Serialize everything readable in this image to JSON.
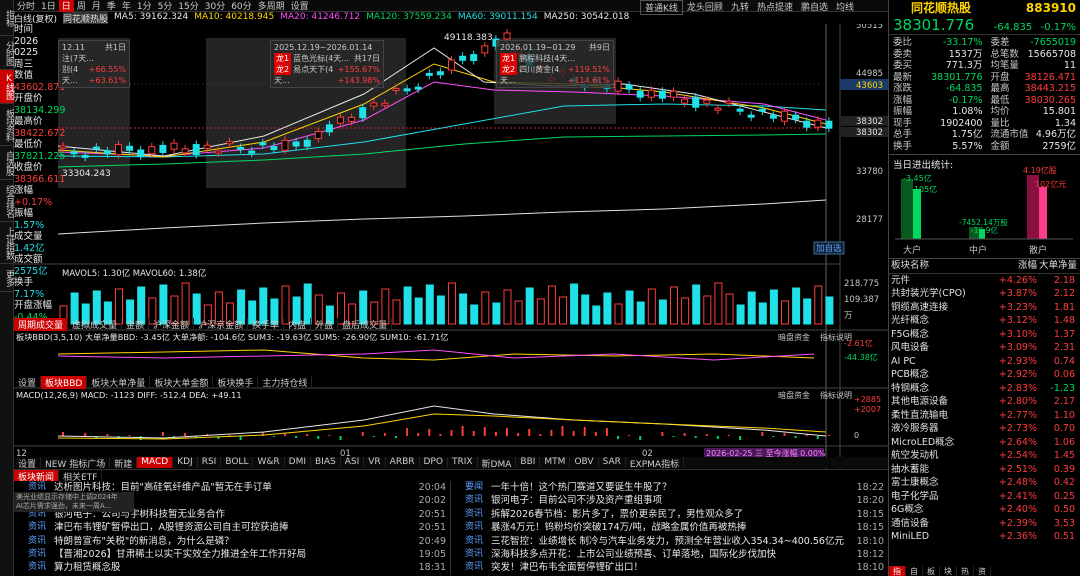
{
  "leftbar": [
    "指标",
    "分时图",
    "K线图",
    "板块资料",
    "自选股",
    "综合排名",
    "上证指数",
    "更多"
  ],
  "toolbar": {
    "items": [
      "分时",
      "1日",
      "日",
      "周",
      "月",
      "季",
      "年",
      "1分",
      "5分",
      "15分",
      "30分",
      "60分",
      "多周期",
      "设置"
    ],
    "active": "日",
    "right": [
      "普通K线",
      "龙头回顾",
      "九转",
      "热点提速",
      "鹏自选",
      "均线"
    ]
  },
  "legend": {
    "name": "白线(复权)",
    "stock": "同花顺热股",
    "ma5": "MA5: 39162.324",
    "ma10": "MA10: 40218.945",
    "ma20": "MA20: 41246.712",
    "ma120": "MA120: 37559.234",
    "ma60": "MA60: 39011.154",
    "ma250": "MA250: 30542.018"
  },
  "info": {
    "time_label": "时间",
    "date1": "2026",
    "date2": "0225",
    "weekday": "周三",
    "count_label": "数值",
    "count": "43602.871",
    "open_label": "开盘价",
    "open": "38134.299",
    "high_label": "最高价",
    "high": "38422.672",
    "low_label": "最低价",
    "low": "37821.225",
    "close_label": "收盘价",
    "close": "38366.611",
    "chg_label": "涨幅",
    "chg": "+0.17%",
    "amp_label": "振幅",
    "amp": "1.57%",
    "vol_label": "成交量",
    "vol": "1.42亿",
    "amt_label": "成交额",
    "amt": "2575亿",
    "turn_label": "换手",
    "turn": "7.17%",
    "up_label": "开盘涨幅",
    "up": "-0.44%"
  },
  "box1": {
    "range": "12.11",
    "count": "共1日",
    "r1n": "注(7天...",
    "r1v": "+66.55%",
    "r2n": "别(4天...",
    "r2v": "+63.61%"
  },
  "box2": {
    "range": "2025.12.19~2026.01.14",
    "count": "共17日",
    "r1t": "龙1",
    "r1n": "蓝色光标(4天...",
    "r1v": "+155.67%",
    "r2t": "龙2",
    "r2n": "易点天下(4天...",
    "r2v": "+143.98%"
  },
  "box3": {
    "range": "2026.01.19~01.29",
    "count": "共9日",
    "r1t": "龙1",
    "r1n": "鹏程科技(4天...",
    "r1v": "+119.51%",
    "r2t": "龙2",
    "r2n": "四川黄金(4天...",
    "r2v": "+114.61%"
  },
  "price_axis": [
    "50515",
    "44985",
    "43603",
    "38302",
    "38302",
    "33780",
    "28177"
  ],
  "peak_label": "49118.383",
  "trough_label": "33304.243",
  "addsel": "加自选",
  "volume": {
    "legend": "MAVOL5: 1.30亿  MAVOL60: 1.38亿",
    "axis": [
      "218.775",
      "109.387",
      "万"
    ]
  },
  "subtabs": [
    "周期成交量",
    "虚拟成交量",
    "金额",
    "沪深金额",
    "沪深京金额",
    "换手率",
    "内盘",
    "外盘",
    "盘后成交量"
  ],
  "bbd": {
    "legend": "板块BBD(3,5,10)  大单净量BBD: -3.45亿  大单净额: -104.6亿  SUM3: -19.63亿  SUM5: -26.90亿  SUM10: -61.71亿",
    "axis": [
      "-2.61亿",
      "-44.38亿"
    ],
    "btn1": "暗盘资金",
    "btn2": "指标说明"
  },
  "bbdtabs": [
    "设置",
    "板块BBD",
    "板块大单净量",
    "板块大单金额",
    "板块换手",
    "主力持仓线"
  ],
  "macd": {
    "legend": "MACD(12,26,9)  MACD: -1123  DIFF: -512.4  DEA: +49.11",
    "axis": [
      "+2885",
      "+2007",
      "0"
    ],
    "btn1": "暗盘资金",
    "btn2": "指标说明"
  },
  "xaxis": {
    "l1": "12",
    "l2": "01",
    "l3": "02",
    "hl": "2026-02-25 三 至今涨幅 0.00%"
  },
  "indtabs": [
    "设置",
    "NEW 指标广场",
    "新建",
    "MACD",
    "KDJ",
    "RSI",
    "BOLL",
    "W&R",
    "DMI",
    "BIAS",
    "ASI",
    "VR",
    "ARBR",
    "DPO",
    "TRIX",
    "新DMA",
    "BBI",
    "MTM",
    "OBV",
    "SAR",
    "EXPMA指标"
  ],
  "newstabs": [
    "板块新闻",
    "相关ETF"
  ],
  "news_left": [
    {
      "tag": "资讯",
      "title": "达析图片科技：目前\"高硅氧纤维产品\"暂无在手订单",
      "time": "20:04"
    },
    {
      "tag": "资讯",
      "title": "...发布利空!",
      "time": "20:02"
    },
    {
      "tag": "资讯",
      "title": "银河电子：公司与宇树科技暂无业务合作",
      "time": "20:51"
    },
    {
      "tag": "资讯",
      "title": "津巴布韦锂矿暂停出口，A股锂资源公司自主可控获追捧",
      "time": "20:51"
    },
    {
      "tag": "资讯",
      "title": "特朗普宣布\"关税\"的新消息，为什么是磷？",
      "time": "20:49"
    },
    {
      "tag": "资讯",
      "title": "【晋湘2026】甘肃稀土以实干实效全力推进全年工作开好局",
      "time": "19:05"
    },
    {
      "tag": "资讯",
      "title": "算力租赁概念股",
      "time": "18:31"
    }
  ],
  "news_right": [
    {
      "tag": "要闻",
      "title": "一年十倍！这个热门赛道又要诞生牛股了？",
      "time": "18:22"
    },
    {
      "tag": "资讯",
      "title": "银河电子：目前公司不涉及资产重组事项",
      "time": "18:20"
    },
    {
      "tag": "资讯",
      "title": "拆解2026春节档：影片多了，票价更亲民了，男性观众多了",
      "time": "18:15"
    },
    {
      "tag": "资讯",
      "title": "暴涨4万元！钨粉均价突破174万/吨，战略金属价值再被热捧",
      "time": "18:15"
    },
    {
      "tag": "资讯",
      "title": "三花智控：业绩增长 制冷与汽车业务发力，预测全年营业收入354.34~400.56亿元",
      "time": "18:10"
    },
    {
      "tag": "资讯",
      "title": "深海科技多点开花：上市公司业绩预喜、订单落地，国际化步伐加快",
      "time": "18:12"
    },
    {
      "tag": "资讯",
      "title": "突发！津巴布韦全面暂停锂矿出口！",
      "time": "18:10"
    }
  ],
  "popup": {
    "l1": "美光业绩显示存储中上调2024年",
    "l2": "AI芯片需求强劲，未来一周A..."
  },
  "quote": {
    "title": "同花顺热股",
    "code": "883910",
    "price": "38301.776",
    "chg": "-64.835",
    "pct": "-0.17%",
    "rows": [
      [
        "委比",
        "-33.17%",
        "委差",
        "-7655019"
      ],
      [
        "委卖",
        "1537万",
        "总笔数",
        "15665708"
      ],
      [
        "委买",
        "771.3万",
        "均笔量",
        "11"
      ],
      [
        "最新",
        "38301.776",
        "开盘",
        "38126.471"
      ],
      [
        "涨跌",
        "-64.835",
        "最高",
        "38443.215"
      ],
      [
        "涨幅",
        "-0.17%",
        "最低",
        "38030.265"
      ],
      [
        "振幅",
        "1.08%",
        "均价",
        "15.801"
      ],
      [
        "现手",
        "1902400",
        "量比",
        "1.34"
      ],
      [
        "总手",
        "1.75亿",
        "流通市值",
        "4.96万亿"
      ],
      [
        "换手",
        "5.57%",
        "金额",
        "2759亿"
      ]
    ]
  },
  "flow": {
    "title": "当日进出统计:",
    "big": "大户",
    "mid": "中户",
    "small": "散户",
    "b1": "-3.45亿",
    "b2": "-105亿",
    "m1": "-7452.14万股",
    "m2": "-18.9亿",
    "s1": "4.19亿股",
    "s2": "102亿元"
  },
  "sectors": {
    "header": [
      "板块名称",
      "涨幅",
      "大单净量"
    ],
    "rows": [
      [
        "元件",
        "+4.26%",
        "2.18"
      ],
      [
        "共封装光学(CPO)",
        "+3.87%",
        "2.12"
      ],
      [
        "铜缆高速连接",
        "+3.23%",
        "1.81"
      ],
      [
        "光纤概念",
        "+3.12%",
        "1.48"
      ],
      [
        "F5G概念",
        "+3.10%",
        "1.37"
      ],
      [
        "风电设备",
        "+3.09%",
        "2.31"
      ],
      [
        "AI PC",
        "+2.93%",
        "0.74"
      ],
      [
        "PCB概念",
        "+2.92%",
        "0.06"
      ],
      [
        "特钢概念",
        "+2.83%",
        "-1.23"
      ],
      [
        "其他电源设备",
        "+2.80%",
        "2.17"
      ],
      [
        "柔性直流输电",
        "+2.77%",
        "1.10"
      ],
      [
        "液冷服务器",
        "+2.73%",
        "0.70"
      ],
      [
        "MicroLED概念",
        "+2.64%",
        "1.06"
      ],
      [
        "航空发动机",
        "+2.54%",
        "1.45"
      ],
      [
        "抽水蓄能",
        "+2.51%",
        "0.39"
      ],
      [
        "富士康概念",
        "+2.48%",
        "0.42"
      ],
      [
        "电子化学品",
        "+2.41%",
        "0.25"
      ],
      [
        "6G概念",
        "+2.40%",
        "0.50"
      ],
      [
        "通信设备",
        "+2.39%",
        "3.53"
      ],
      [
        "MiniLED",
        "+2.36%",
        "0.51"
      ]
    ]
  },
  "rtabs": [
    "指",
    "自",
    "板",
    "块",
    "热",
    "资"
  ],
  "colors": {
    "up": "#ff3c3c",
    "down": "#20e0e8",
    "bg": "#000000"
  }
}
